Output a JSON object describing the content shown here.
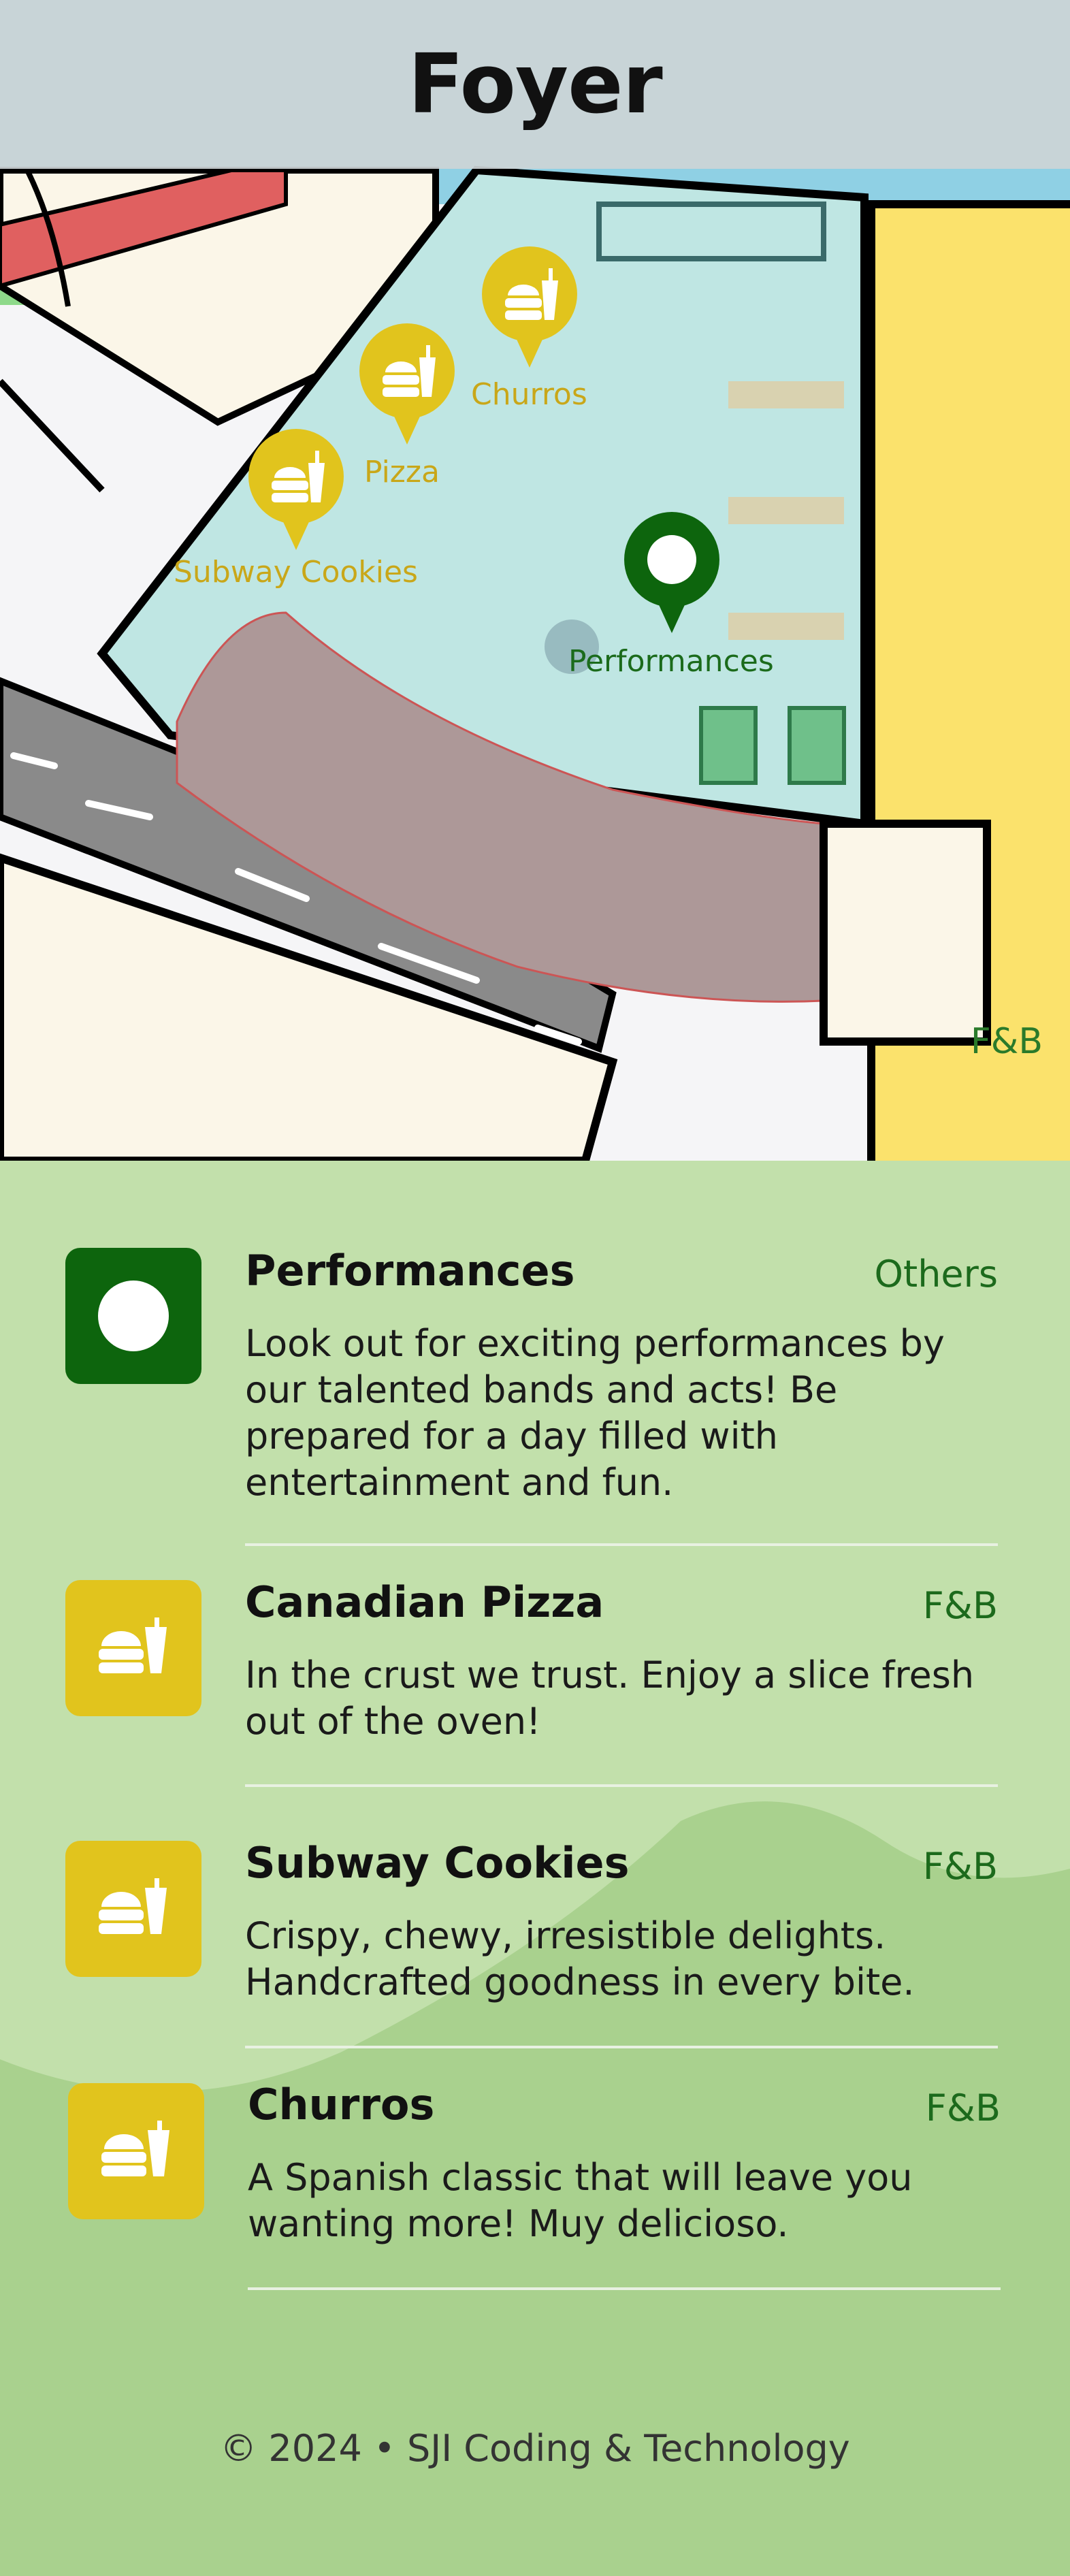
{
  "header": {
    "title": "Foyer"
  },
  "colors": {
    "fb": "#e1c41d",
    "performance": "#0d650d",
    "list_bg": "#c2e0ab",
    "page_bg": "#a9d18e"
  },
  "map": {
    "pins": [
      {
        "label": "Churros",
        "type": "fb",
        "icon": "food-icon"
      },
      {
        "label": "Pizza",
        "type": "fb",
        "icon": "food-icon"
      },
      {
        "label": "Subway Cookies",
        "type": "fb",
        "icon": "food-icon"
      },
      {
        "label": "Performances",
        "type": "performance",
        "icon": "circle-icon"
      }
    ],
    "category_label": "F&B"
  },
  "list": {
    "items": [
      {
        "title": "Performances",
        "category": "Others",
        "icon": "circle-icon",
        "description": "Look out for exciting performances by our talented bands and acts! Be prepared for a day filled with entertainment and fun."
      },
      {
        "title": "Canadian Pizza",
        "category": "F&B",
        "icon": "food-icon",
        "description": "In the crust we trust. Enjoy a slice fresh out of the oven!"
      },
      {
        "title": "Subway Cookies",
        "category": "F&B",
        "icon": "food-icon",
        "description": "Crispy, chewy, irresistible delights. Handcrafted goodness in every bite."
      },
      {
        "title": "Churros",
        "category": "F&B",
        "icon": "food-icon",
        "description": "A Spanish classic that will leave you wanting more! Muy delicioso."
      }
    ]
  },
  "footer": {
    "text": "© 2024 • SJI Coding & Technology"
  }
}
